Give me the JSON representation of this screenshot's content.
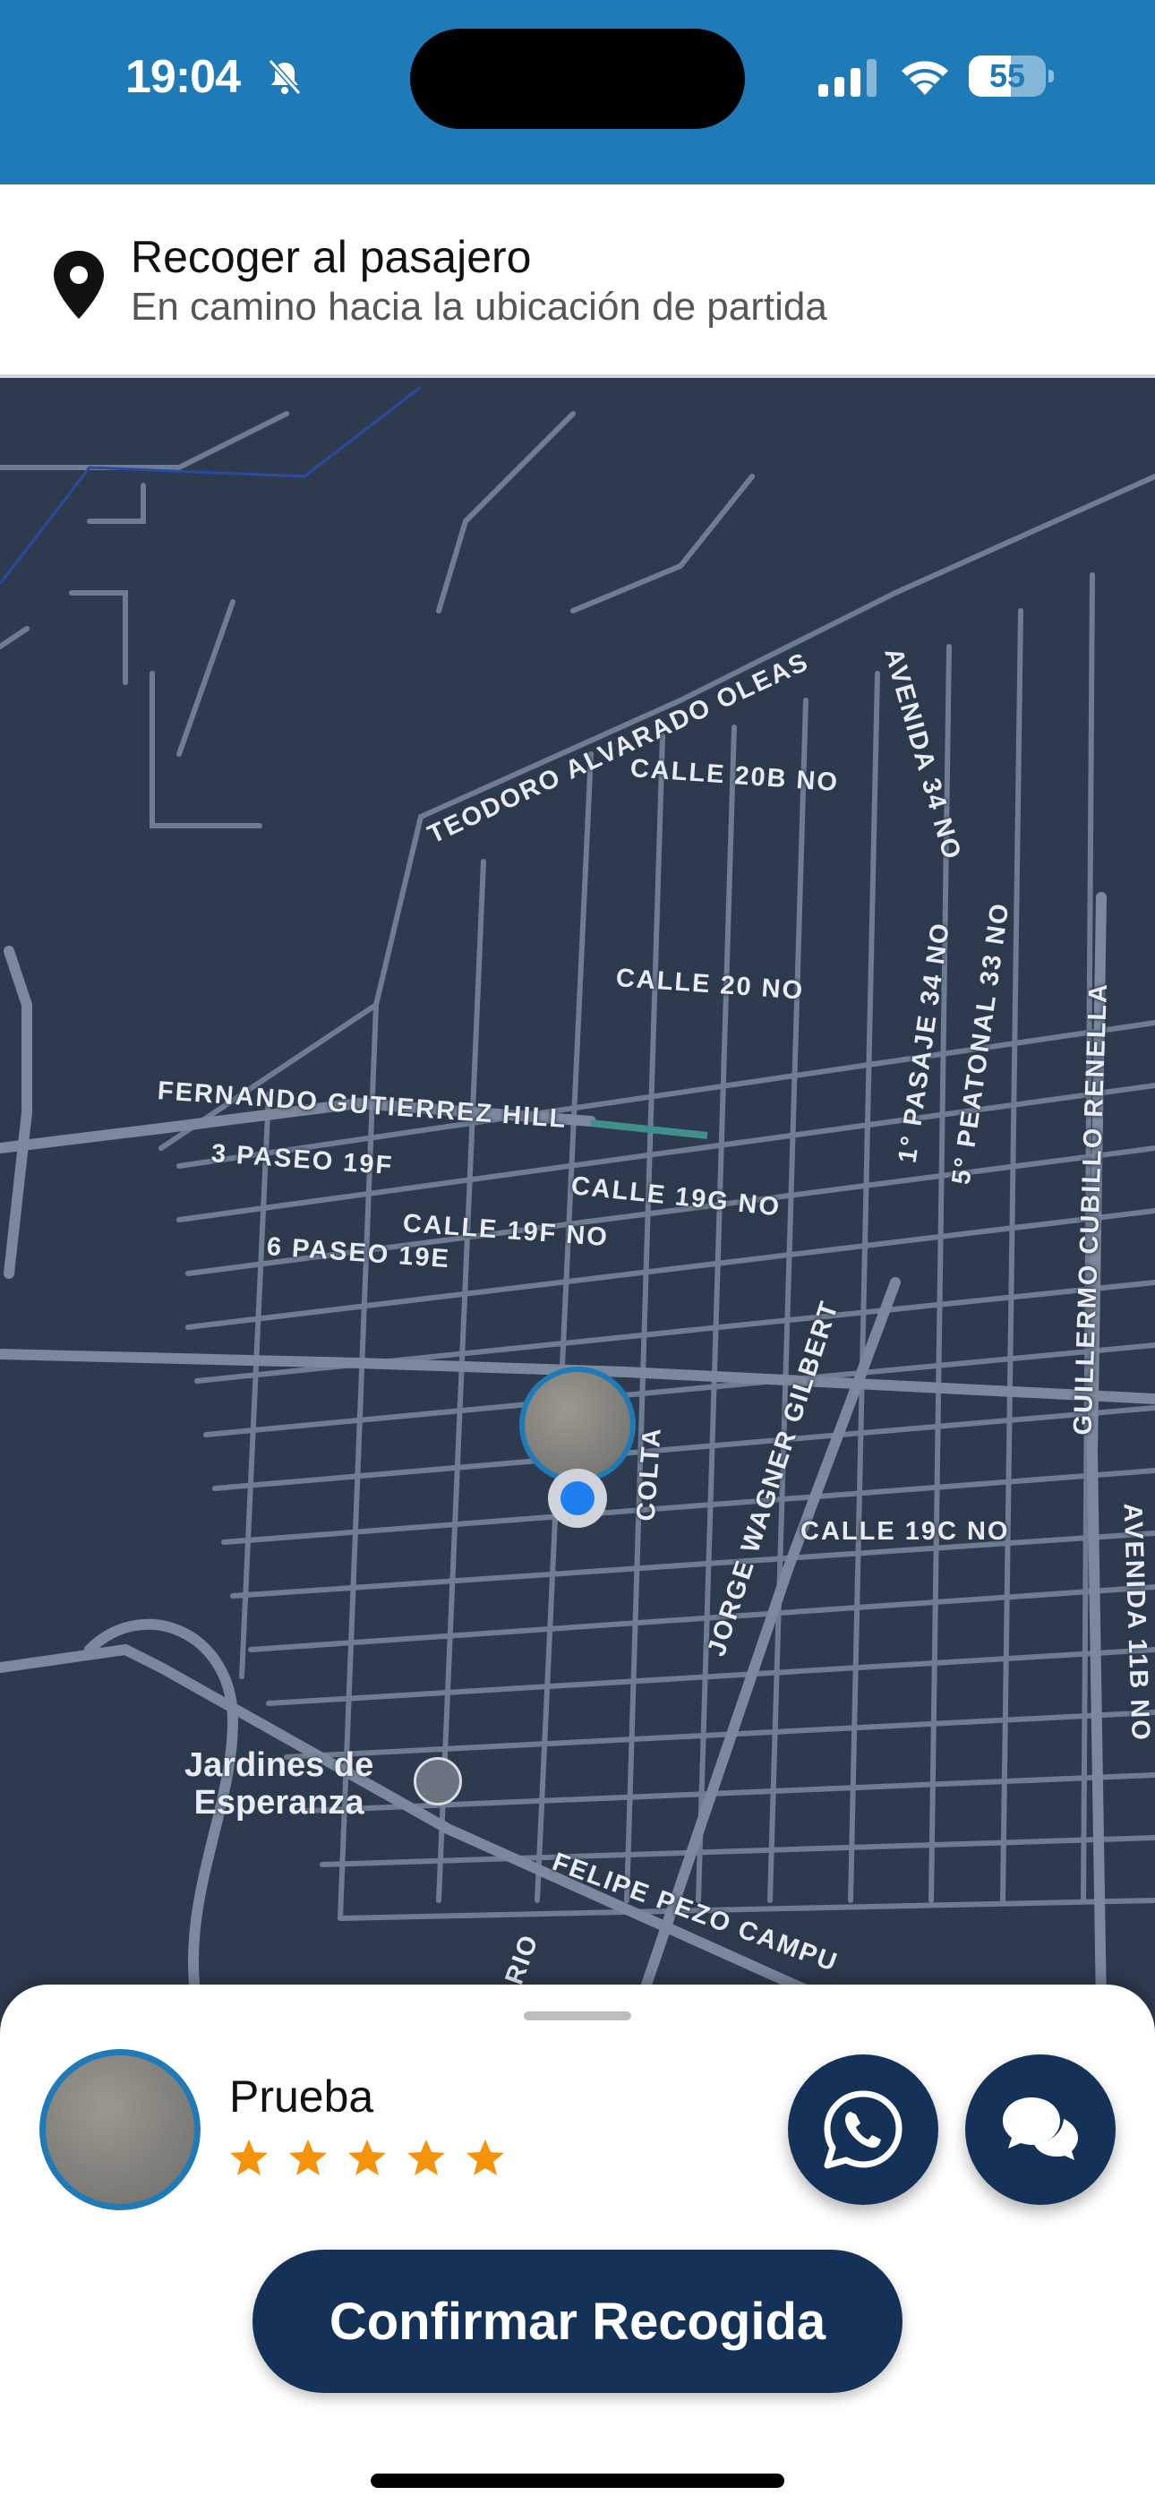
{
  "status_bar": {
    "time": "19:04",
    "battery": "55",
    "battery_level": 0.55,
    "icons": [
      "bell-slash-icon",
      "cellular-signal-icon",
      "wifi-icon",
      "battery-icon"
    ]
  },
  "header": {
    "icon": "location-pin-icon",
    "title": "Recoger al pasajero",
    "subtitle": "En camino hacia la ubicación de partida"
  },
  "map": {
    "streets": [
      "TEODORO ALVARADO OLEAS",
      "CALLE 20B NO",
      "AVENIDA 34 NO",
      "CALLE 20 NO",
      "1° PASAJE 34 NO",
      "5° PEATONAL 33 NO",
      "GUILLERMO CUBILLO RENELLA",
      "FERNANDO GUTIERREZ HILL",
      "3 PASEO 19F",
      "CALLE 19G NO",
      "CALLE 19F NO",
      "6 PASEO 19E",
      "COLTA",
      "JORGE WAGNER GILBERT",
      "CALLE 19C NO",
      "AVENIDA 11B NO",
      "FELIPE PEZO CAMPU",
      "ARIO"
    ],
    "poi": {
      "name_line1": "Jardines de",
      "name_line2": "Esperanza",
      "icon": "cemetery-icon"
    }
  },
  "passenger": {
    "name": "Prueba",
    "rating": 5,
    "rating_max": 5
  },
  "actions": {
    "whatsapp_icon": "whatsapp-icon",
    "chat_icon": "chat-bubbles-icon",
    "confirm_label": "Confirmar Recogida"
  },
  "colors": {
    "status_bar": "#1f7bb8",
    "primary_button": "#143158",
    "star": "#f5930b",
    "map_background": "#2e3b4f",
    "map_roads": "#6f7d93"
  }
}
